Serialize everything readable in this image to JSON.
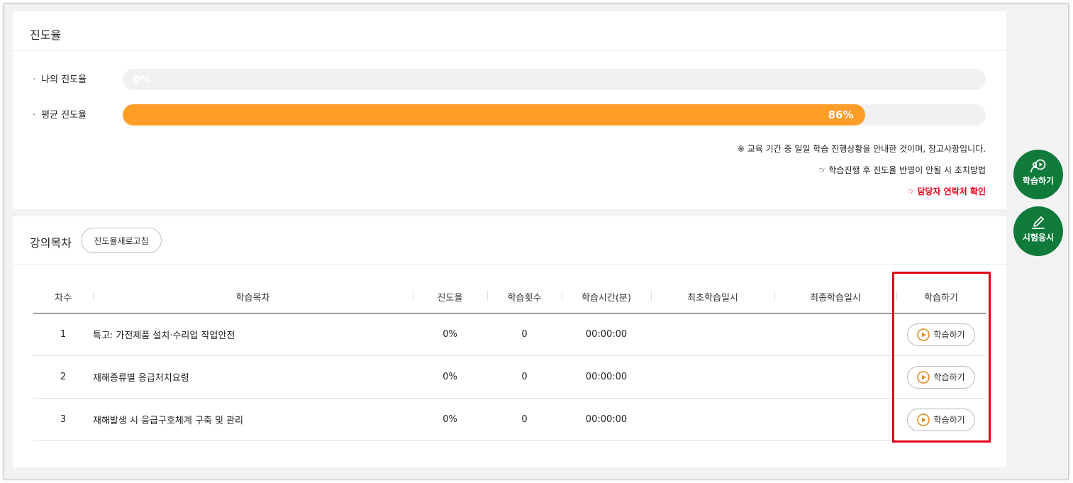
{
  "progress": {
    "title": "진도율",
    "rows": [
      {
        "label": "나의 진도율",
        "value_text": "0%",
        "percent": 0
      },
      {
        "label": "평균 진도율",
        "value_text": "86%",
        "percent": 86
      }
    ],
    "notes": {
      "info": "※ 교육 기간 중 일일 학습 진행상황을 안내한 것이며, 참고사항입니다.",
      "link1": "학습진행 후 진도율 반영이 안될 시 조치방법",
      "link2": "담당자 연락처 확인",
      "hand": "☞"
    },
    "colors": {
      "fill": "#ff9d28",
      "track": "#f1f1f1",
      "accent_red": "#e8001c"
    }
  },
  "lecture": {
    "title": "강의목차",
    "refresh_label": "진도율새로고침",
    "columns": [
      "차수",
      "학습목차",
      "진도율",
      "학습횟수",
      "학습시간(분)",
      "최초학습일시",
      "최종학습일시",
      "학습하기"
    ],
    "rows": [
      {
        "no": "1",
        "title": "특고: 가전제품 설치·수리업 작업안전",
        "progress": "0%",
        "count": "0",
        "time": "00:00:00",
        "first": "",
        "last": "",
        "action": "학습하기"
      },
      {
        "no": "2",
        "title": "재해종류별 응급처치요령",
        "progress": "0%",
        "count": "0",
        "time": "00:00:00",
        "first": "",
        "last": "",
        "action": "학습하기"
      },
      {
        "no": "3",
        "title": "재해발생 시 응급구호체계 구축 및 관리",
        "progress": "0%",
        "count": "0",
        "time": "00:00:00",
        "first": "",
        "last": "",
        "action": "학습하기"
      }
    ]
  },
  "floating": {
    "study_label": "학습하기",
    "exam_label": "시험응시",
    "color": "#0f7a3a"
  }
}
